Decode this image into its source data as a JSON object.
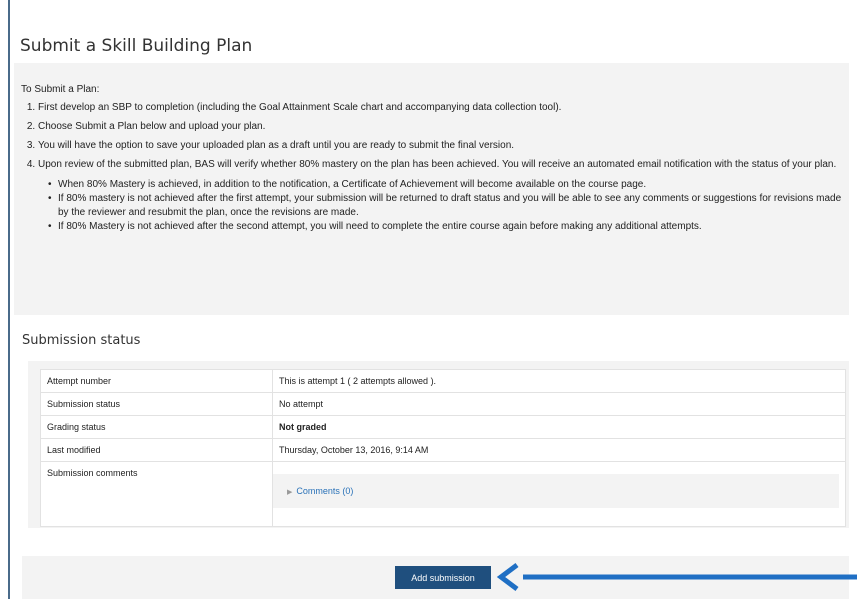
{
  "page": {
    "title": "Submit a Skill Building Plan"
  },
  "intro": {
    "lead": "To Submit a Plan:",
    "steps": [
      "First develop an SBP to completion (including the Goal Attainment Scale chart and accompanying data collection tool).",
      "Choose Submit a Plan below and upload your plan.",
      "You will have the option to save your uploaded plan as a draft until you are ready to submit the final version.",
      "Upon review of the submitted plan, BAS will verify whether 80% mastery on the plan has been achieved. You will receive an automated email notification with the status of your plan."
    ],
    "bullets": [
      "When 80% Mastery is achieved, in addition to the notification, a Certificate of Achievement will become available on the course page.",
      "If 80% mastery is not achieved after the first attempt, your submission will be returned to draft status and you will be able to see any comments or suggestions for revisions made by the reviewer and resubmit the plan, once the revisions are made.",
      "If 80% Mastery is not achieved after the second attempt, you will need to complete the entire course again before making any additional attempts."
    ]
  },
  "submission": {
    "heading": "Submission status",
    "rows": [
      {
        "label": "Attempt number",
        "value": "This is attempt 1 ( 2 attempts allowed )."
      },
      {
        "label": "Submission status",
        "value": "No attempt"
      },
      {
        "label": "Grading status",
        "value": "Not graded"
      },
      {
        "label": "Last modified",
        "value": "Thursday, October 13, 2016, 9:14 AM"
      },
      {
        "label": "Submission comments",
        "value": "Comments (0)"
      }
    ]
  },
  "actions": {
    "add_submission": "Add submission"
  },
  "colors": {
    "button": "#1f4f7e",
    "arrow": "#1f6fc4",
    "link": "#2a72b8"
  }
}
